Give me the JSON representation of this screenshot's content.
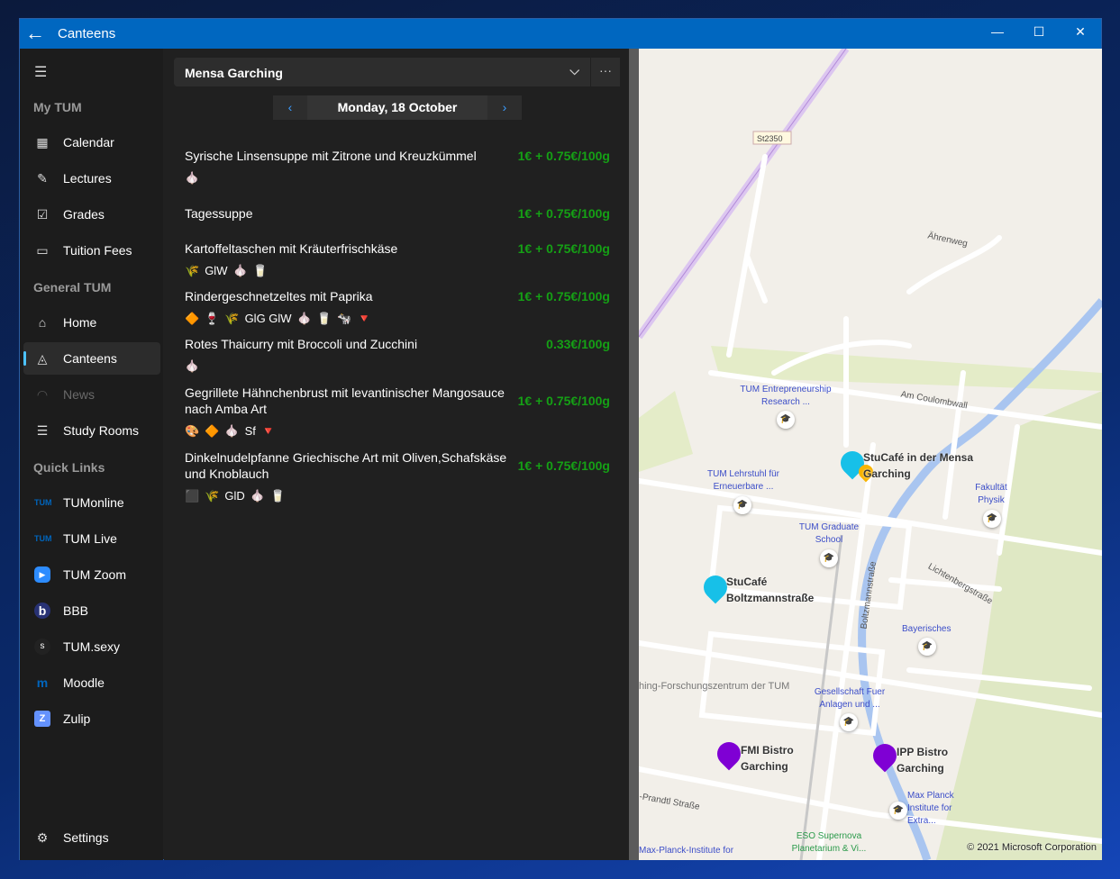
{
  "window": {
    "title": "Canteens",
    "minimize": "—",
    "maximize": "☐",
    "close": "✕",
    "back_icon": "←"
  },
  "sidebar": {
    "sections": {
      "my_tum": "My TUM",
      "general_tum": "General TUM",
      "quick_links": "Quick Links"
    },
    "items": [
      {
        "label": "Calendar",
        "icon": "▦"
      },
      {
        "label": "Lectures",
        "icon": "✎"
      },
      {
        "label": "Grades",
        "icon": "☑"
      },
      {
        "label": "Tuition Fees",
        "icon": "▭"
      },
      {
        "label": "Home",
        "icon": "⌂"
      },
      {
        "label": "Canteens",
        "icon": "◬"
      },
      {
        "label": "News",
        "icon": "◠"
      },
      {
        "label": "Study Rooms",
        "icon": "☰"
      },
      {
        "label": "TUMonline",
        "icon": "TUM"
      },
      {
        "label": "TUM Live",
        "icon": "TUM"
      },
      {
        "label": "TUM Zoom",
        "icon": "▶"
      },
      {
        "label": "BBB",
        "icon": "b"
      },
      {
        "label": "TUM.sexy",
        "icon": "s"
      },
      {
        "label": "Moodle",
        "icon": "m"
      },
      {
        "label": "Zulip",
        "icon": "Z"
      }
    ],
    "settings": "Settings"
  },
  "content": {
    "canteen": "Mensa Garching",
    "more": "···",
    "date": "Monday, 18 October",
    "prev": "‹",
    "next": "›",
    "dishes": [
      {
        "name": "Syrische Linsensuppe mit Zitrone und Kreuzkümmel",
        "price": "1€ + 0.75€/100g",
        "tags": [
          "🧄"
        ]
      },
      {
        "name": "Tagessuppe",
        "price": "1€ + 0.75€/100g",
        "tags": []
      },
      {
        "name": "Kartoffeltaschen mit Kräuterfrischkäse",
        "price": "1€ + 0.75€/100g",
        "tags": [
          "🌾",
          "GlW",
          "🧄",
          "🥛"
        ]
      },
      {
        "name": "Rindergeschnetzeltes mit Paprika",
        "price": "1€ + 0.75€/100g",
        "tags": [
          "🔶",
          "🍷",
          "🌾",
          "GlG GlW",
          "🧄",
          "🥛",
          "🐄",
          "🔻"
        ]
      },
      {
        "name": "Rotes Thaicurry mit Broccoli und Zucchini",
        "price": "0.33€/100g",
        "tags": [
          "🧄"
        ]
      },
      {
        "name": "Gegrillete Hähnchenbrust mit levantinischer Mangosauce nach Amba Art",
        "price": "1€ + 0.75€/100g",
        "tags": [
          "🎨",
          "🔶",
          "🧄",
          "Sf",
          "🔻"
        ]
      },
      {
        "name": "Dinkelnudelpfanne Griechische Art mit Oliven,Schafskäse und Knoblauch",
        "price": "1€ + 0.75€/100g",
        "tags": [
          "⬛",
          "🌾",
          "GlD",
          "🧄",
          "🥛"
        ]
      }
    ]
  },
  "map": {
    "roads": {
      "st2350": "St2350",
      "ahrenweg": "Ährenweg",
      "coulombwall": "Am Coulombwall",
      "boltzmann": "Boltzmannstraße",
      "lichtenberg": "Lichtenbergstraße",
      "prandtl": "-Prandtl Straße",
      "forschung": "hing-Forschungszentrum der TUM"
    },
    "pois": [
      "TUM Entrepreneurship Research ...",
      "TUM Lehrstuhl für Erneuerbare ...",
      "TUM Graduate School",
      "Fakultät Physik",
      "Bayerisches",
      "Gesellschaft Fuer Anlagen und ...",
      "Max Planck Institute for Extra...",
      "ESO Supernova Planetarium & Vi...",
      "Max-Planck-Institute for"
    ],
    "canteens": [
      "StuCafé in der Mensa Garching",
      "StuCafé Boltzmannstraße",
      "FMI Bistro Garching",
      "IPP Bistro Garching"
    ],
    "copyright": "© 2021 Microsoft Corporation"
  }
}
